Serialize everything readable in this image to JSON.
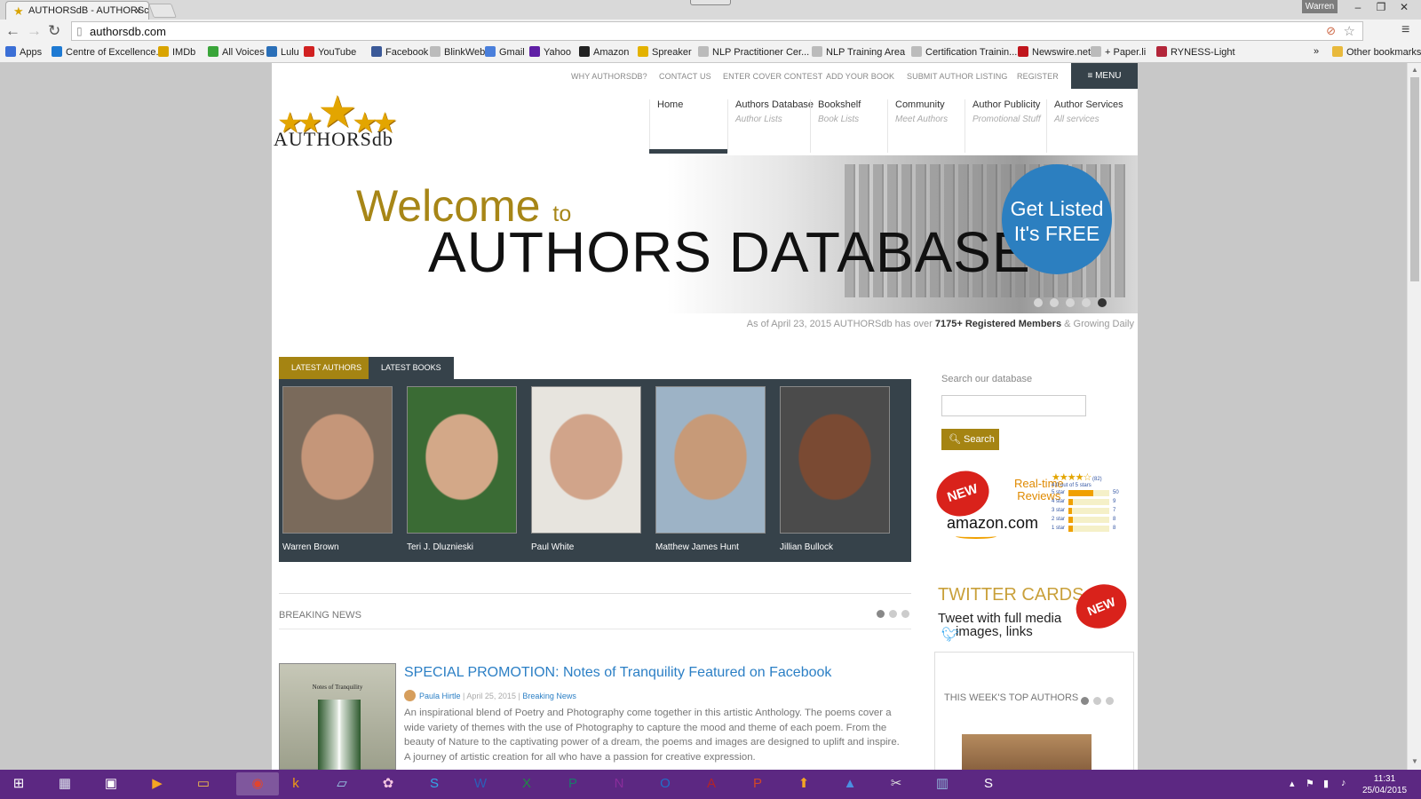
{
  "browser": {
    "tab_title": "AUTHORSdB - AUTHORSc",
    "tab_close": "×",
    "profile": "Warren",
    "url": "authorsdb.com",
    "bookmarks": [
      {
        "label": "Apps",
        "icon": "apps-grid-icon",
        "color": "#3b6fd6"
      },
      {
        "label": "Centre of Excellence...",
        "icon": "u-icon",
        "color": "#1e7ad3"
      },
      {
        "label": "IMDb",
        "icon": "imdb-icon",
        "color": "#d9a400"
      },
      {
        "label": "All Voices",
        "icon": "allvoices-icon",
        "color": "#3aa53a"
      },
      {
        "label": "Lulu",
        "icon": "lulu-icon",
        "color": "#2a6fb8"
      },
      {
        "label": "YouTube",
        "icon": "youtube-icon",
        "color": "#d12121"
      },
      {
        "label": "Facebook",
        "icon": "facebook-icon",
        "color": "#3b5998"
      },
      {
        "label": "BlinkWeb",
        "icon": "page-icon",
        "color": "#bbbbbb"
      },
      {
        "label": "Gmail",
        "icon": "google-icon",
        "color": "#4a7fdb"
      },
      {
        "label": "Yahoo",
        "icon": "yahoo-icon",
        "color": "#5f1fa5"
      },
      {
        "label": "Amazon",
        "icon": "amazon-icon",
        "color": "#222222"
      },
      {
        "label": "Spreaker",
        "icon": "spreaker-icon",
        "color": "#e3b200"
      },
      {
        "label": "NLP Practitioner Cer...",
        "icon": "page-icon",
        "color": "#bbbbbb"
      },
      {
        "label": "NLP Training Area",
        "icon": "page-icon",
        "color": "#bbbbbb"
      },
      {
        "label": "Certification Trainin...",
        "icon": "page-icon",
        "color": "#bbbbbb"
      },
      {
        "label": "Newswire.net",
        "icon": "newswire-icon",
        "color": "#c0161d"
      },
      {
        "label": "+ Paper.li",
        "icon": "page-icon",
        "color": "#bbbbbb"
      },
      {
        "label": "RYNESS-Light",
        "icon": "ryness-icon",
        "color": "#b3263a"
      }
    ],
    "bookmarks_more": "»",
    "other_bookmarks": "Other bookmarks"
  },
  "site": {
    "top_links": [
      "WHY AUTHORSDB?",
      "CONTACT US",
      "ENTER COVER CONTEST",
      "ADD YOUR BOOK",
      "SUBMIT AUTHOR LISTING",
      "REGISTER"
    ],
    "menu_label": "≡ MENU",
    "logo_text": "AUTHORSdb",
    "nav": [
      {
        "title": "Home",
        "sub": ""
      },
      {
        "title": "Authors Database",
        "sub": "Author Lists"
      },
      {
        "title": "Bookshelf",
        "sub": "Book Lists"
      },
      {
        "title": "Community",
        "sub": "Meet Authors"
      },
      {
        "title": "Author Publicity",
        "sub": "Promotional Stuff"
      },
      {
        "title": "Author Services",
        "sub": "All services"
      }
    ],
    "hero": {
      "welcome": "Welcome",
      "to": "to",
      "title": "AUTHORS DATABASE",
      "badge_line1": "Get Listed",
      "badge_line2": "It's FREE",
      "active_slide": 5,
      "slide_count": 5
    },
    "members": {
      "prefix": "As of April 23, 2015 AUTHORSdb has over",
      "count": "7175+ Registered Members",
      "suffix": "& Growing Daily"
    },
    "tabs": {
      "latest_authors": "LATEST AUTHORS",
      "latest_books": "LATEST BOOKS"
    },
    "authors": [
      {
        "name": "Warren Brown",
        "bg": "#7a6a5b",
        "skin": "#c59679"
      },
      {
        "name": "Teri J. Dluznieski",
        "bg": "#3a6b34",
        "skin": "#d3a888"
      },
      {
        "name": "Paul White",
        "bg": "#e7e4de",
        "skin": "#d1a48a"
      },
      {
        "name": "Matthew James Hunt",
        "bg": "#9db3c6",
        "skin": "#c79a78"
      },
      {
        "name": "Jillian Bullock",
        "bg": "#4b4b4b",
        "skin": "#7a4a33"
      }
    ],
    "search": {
      "label": "Search our database",
      "button": "Search",
      "placeholder": ""
    },
    "amazon_ad": {
      "burst": "NEW",
      "line1": "Real-time",
      "line2": "Reviews",
      "brand": "amazon.com",
      "count": "(82)",
      "rating_text": "4.0 out of 5 stars",
      "rows": [
        {
          "label": "5 star",
          "count": "50",
          "fraction": 0.61
        },
        {
          "label": "4 star",
          "count": "9",
          "fraction": 0.11
        },
        {
          "label": "3 star",
          "count": "7",
          "fraction": 0.09
        },
        {
          "label": "2 star",
          "count": "8",
          "fraction": 0.1
        },
        {
          "label": "1 star",
          "count": "8",
          "fraction": 0.1
        }
      ]
    },
    "news": {
      "section": "BREAKING NEWS",
      "headline": "SPECIAL PROMOTION: Notes of Tranquility Featured on Facebook",
      "author": "Paula Hirtle",
      "date": "April 25, 2015",
      "category": "Breaking News",
      "sep": "|",
      "book_title": "Notes of Tranquility",
      "body": "An inspirational blend of Poetry and Photography come together in this artistic Anthology. The poems cover a wide variety of themes with the use of Photography to capture the mood and theme of each poem. From the beauty of Nature to the captivating power of a dream, the poems and images are designed to uplift and inspire. A journey of artistic creation for all who have a passion for creative expression."
    },
    "twitter_ad": {
      "title": "TWITTER CARDS",
      "burst": "NEW",
      "line1": "Tweet with full media",
      "line2": "images, links"
    },
    "top_authors": {
      "label": "THIS WEEK'S TOP AUTHORS"
    }
  },
  "taskbar": {
    "apps": [
      {
        "name": "windows-start-icon",
        "glyph": "⊞",
        "color": "#ffffff"
      },
      {
        "name": "file-explorer-icon",
        "glyph": "▦",
        "color": "#dfe6ee"
      },
      {
        "name": "media-app-icon",
        "glyph": "▣",
        "color": "#ffffff"
      },
      {
        "name": "video-player-icon",
        "glyph": "▶",
        "color": "#f5a623"
      },
      {
        "name": "folder-icon",
        "glyph": "▭",
        "color": "#f3c04b"
      },
      {
        "name": "chrome-icon",
        "glyph": "◉",
        "color": "#e0452f"
      },
      {
        "name": "kindle-icon",
        "glyph": "k",
        "color": "#f39c12"
      },
      {
        "name": "notes-icon",
        "glyph": "▱",
        "color": "#9bd0ea"
      },
      {
        "name": "paint-icon",
        "glyph": "✿",
        "color": "#f6c6e2"
      },
      {
        "name": "skype-icon",
        "glyph": "S",
        "color": "#31a9e8"
      },
      {
        "name": "word-icon",
        "glyph": "W",
        "color": "#2b5fb8"
      },
      {
        "name": "excel-icon",
        "glyph": "X",
        "color": "#1f8a45"
      },
      {
        "name": "publisher-icon",
        "glyph": "P",
        "color": "#1a7b6b"
      },
      {
        "name": "onenote-icon",
        "glyph": "N",
        "color": "#8a2d9b"
      },
      {
        "name": "outlook-icon",
        "glyph": "O",
        "color": "#1f6fc9"
      },
      {
        "name": "access-icon",
        "glyph": "A",
        "color": "#b32428"
      },
      {
        "name": "powerpoint-icon",
        "glyph": "P",
        "color": "#d24726"
      },
      {
        "name": "upload-icon",
        "glyph": "⬆",
        "color": "#f5a623"
      },
      {
        "name": "drive-icon",
        "glyph": "▲",
        "color": "#4a90e2"
      },
      {
        "name": "snipping-icon",
        "glyph": "✂",
        "color": "#dddddd"
      },
      {
        "name": "library-icon",
        "glyph": "▥",
        "color": "#8fb3d9"
      },
      {
        "name": "app-s-icon",
        "glyph": "S",
        "color": "#ffffff"
      }
    ],
    "time": "11:31",
    "date": "25/04/2015"
  }
}
